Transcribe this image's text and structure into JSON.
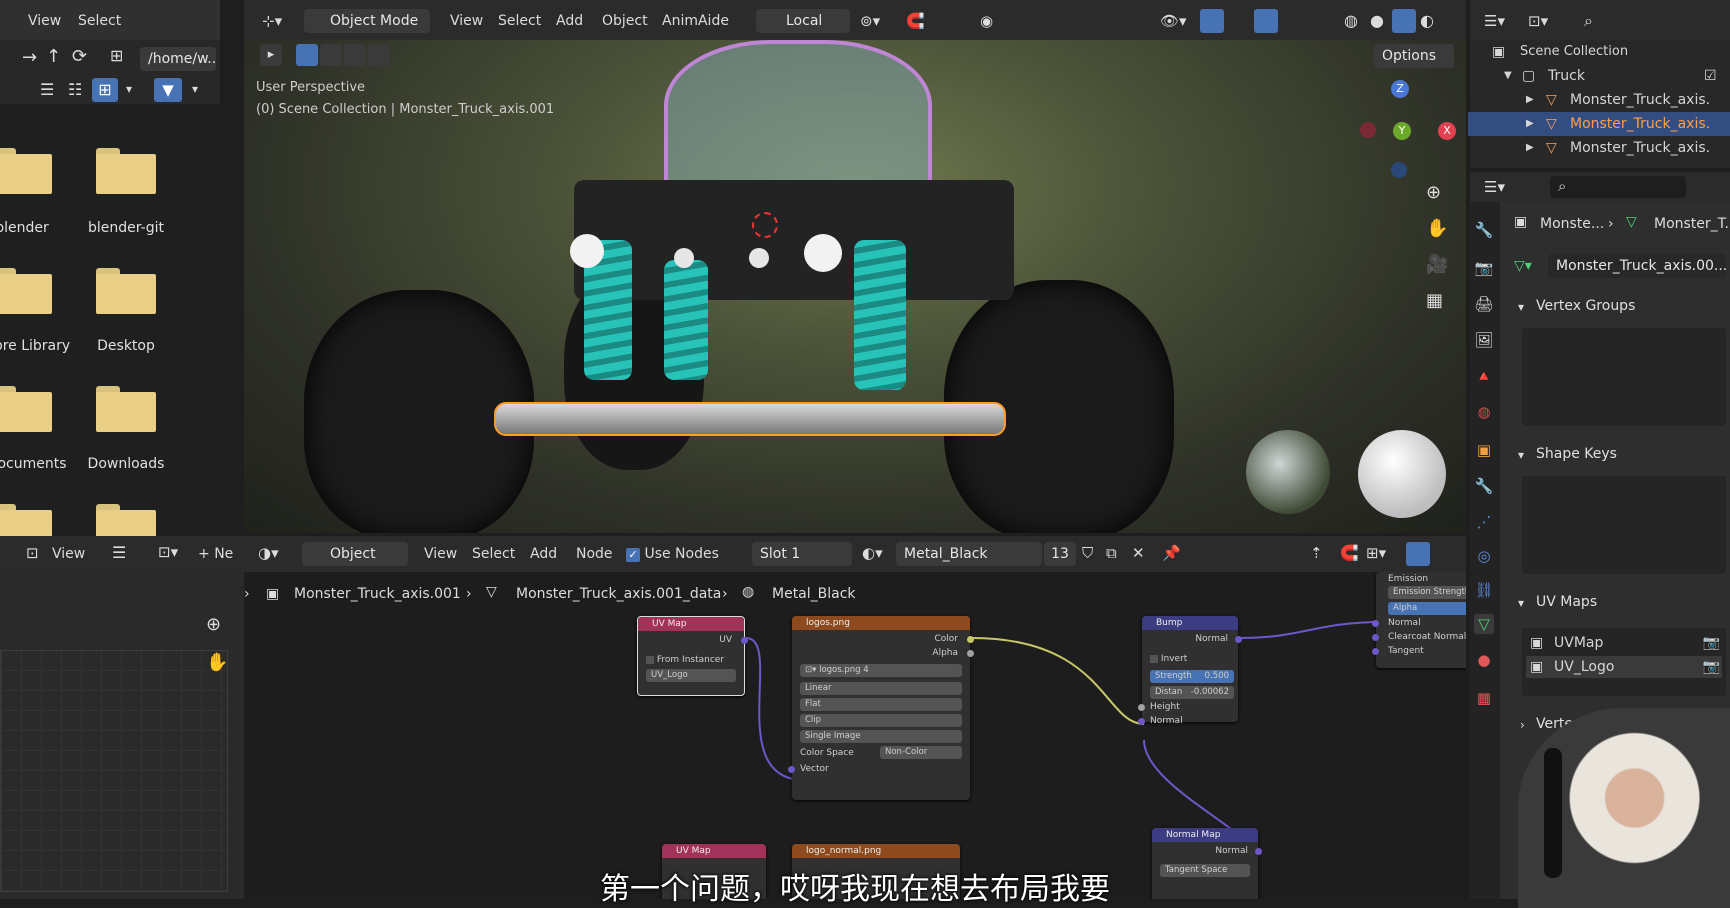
{
  "file_browser": {
    "menu": [
      "View",
      "Select"
    ],
    "path": "/home/w...",
    "folders": [
      {
        "label": "blender"
      },
      {
        "label": "blender-git"
      },
      {
        "label": "bre Library"
      },
      {
        "label": "Desktop"
      },
      {
        "label": "ocuments"
      },
      {
        "label": "Downloads"
      }
    ]
  },
  "viewport": {
    "mode": "Object Mode",
    "menu": [
      "View",
      "Select",
      "Add",
      "Object",
      "AnimAide"
    ],
    "orientation": "Local",
    "options": "Options",
    "overlay_line1": "User Perspective",
    "overlay_line2": "(0) Scene Collection | Monster_Truck_axis.001",
    "gizmo": {
      "z": "Z",
      "y": "Y",
      "x": "X"
    }
  },
  "node_editor": {
    "left_menu": [
      "View"
    ],
    "new_label": "Ne",
    "object_type": "Object",
    "menu": [
      "View",
      "Select",
      "Add",
      "Node"
    ],
    "use_nodes": "Use Nodes",
    "slot": "Slot 1",
    "material": "Metal_Black",
    "users": "13",
    "breadcrumb": [
      "Monster_Truck_axis.001",
      "Monster_Truck_axis.001_data",
      "Metal_Black"
    ],
    "nodes": {
      "uvmap": {
        "title": "UV Map",
        "out": "UV",
        "from_instancer": "From Instancer",
        "map": "UV_Logo"
      },
      "image": {
        "title": "logos.png",
        "out_color": "Color",
        "out_alpha": "Alpha",
        "image_name": "logos.png",
        "users": "4",
        "interp": "Linear",
        "proj": "Flat",
        "ext": "Clip",
        "source": "Single Image",
        "cs_label": "Color Space",
        "cs_value": "Non-Color",
        "in_vector": "Vector"
      },
      "bump": {
        "title": "Bump",
        "out": "Normal",
        "invert": "Invert",
        "strength_label": "Strength",
        "strength": "0.500",
        "dist_label": "Distan",
        "dist": "-0.00062",
        "in_height": "Height",
        "in_normal": "Normal"
      },
      "bsdf_partial": {
        "emission": "Emission",
        "emission_strength": "Emission Strength",
        "alpha": "Alpha",
        "normal": "Normal",
        "clearcoat": "Clearcoat Normal",
        "tangent": "Tangent"
      },
      "uvmap2": {
        "title": "UV Map"
      },
      "image2": {
        "title": "logo_normal.png"
      },
      "normal_map": {
        "title": "Normal Map",
        "out": "Normal",
        "space": "Tangent Space"
      }
    }
  },
  "outliner": {
    "scene_collection": "Scene Collection",
    "collection": "Truck",
    "items": [
      "Monster_Truck_axis.",
      "Monster_Truck_axis.",
      "Monster_Truck_axis."
    ]
  },
  "properties": {
    "breadcrumb_obj": "Monste...",
    "breadcrumb_data": "Monster_T...",
    "mesh_name": "Monster_Truck_axis.00...",
    "sections": {
      "vertex_groups": "Vertex Groups",
      "shape_keys": "Shape Keys",
      "uv_maps": "UV Maps",
      "vertex_colors": "Vertex C"
    },
    "uv_maps": [
      "UVMap",
      "UV_Logo"
    ]
  },
  "subtitle": "第一个问题，哎呀我现在想去布局我要"
}
